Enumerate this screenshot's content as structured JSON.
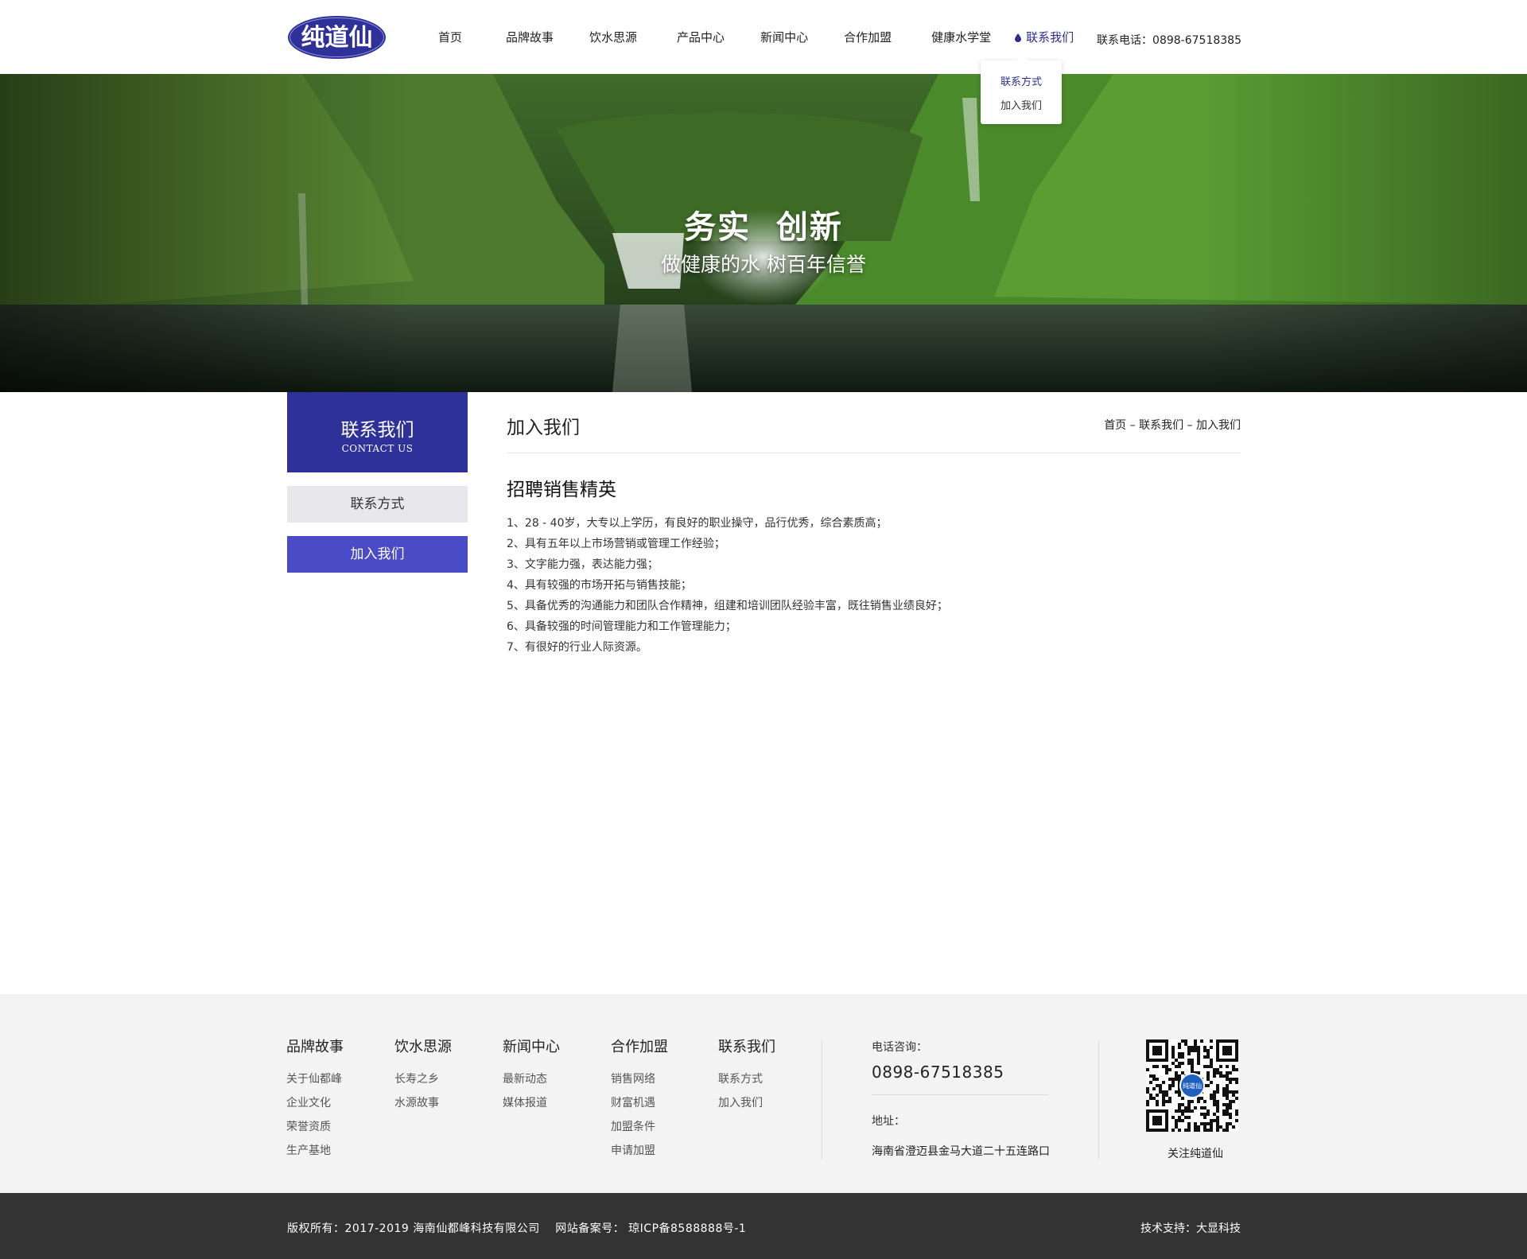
{
  "brand": {
    "logo_text": "纯道仙",
    "accent_color": "#2f319b"
  },
  "nav": {
    "items": [
      {
        "label": "首页"
      },
      {
        "label": "品牌故事"
      },
      {
        "label": "饮水思源"
      },
      {
        "label": "产品中心"
      },
      {
        "label": "新闻中心"
      },
      {
        "label": "合作加盟"
      },
      {
        "label": "健康水学堂"
      },
      {
        "label": "联系我们",
        "active": true
      }
    ],
    "phone": "联系电话：0898-67518385",
    "dropdown": [
      "联系方式",
      "加入我们"
    ]
  },
  "banner": {
    "title": "务实  创新",
    "subtitle": "做健康的水 树百年信誉"
  },
  "sidebar": {
    "heading": "联系我们",
    "heading_en": "CONTACT US",
    "items": [
      "联系方式",
      "加入我们"
    ]
  },
  "content": {
    "title": "加入我们",
    "breadcrumb": "首页 – 联系我们 – 加入我们",
    "article_title": "招聘销售精英",
    "requirements": [
      "1、28 - 40岁，大专以上学历，有良好的职业操守，品行优秀，综合素质高；",
      "2、具有五年以上市场营销或管理工作经验；",
      "3、文字能力强，表达能力强；",
      "4、具有较强的市场开拓与销售技能；",
      "5、具备优秀的沟通能力和团队合作精神，组建和培训团队经验丰富，既往销售业绩良好；",
      "6、具备较强的时间管理能力和工作管理能力；",
      "7、有很好的行业人际资源。"
    ]
  },
  "footer": {
    "columns": [
      {
        "heading": "品牌故事",
        "links": [
          "关于仙都峰",
          "企业文化",
          "荣誉资质",
          "生产基地"
        ]
      },
      {
        "heading": "饮水思源",
        "links": [
          "长寿之乡",
          "水源故事"
        ]
      },
      {
        "heading": "新闻中心",
        "links": [
          "最新动态",
          "媒体报道"
        ]
      },
      {
        "heading": "合作加盟",
        "links": [
          "销售网络",
          "财富机遇",
          "加盟条件",
          "申请加盟"
        ]
      },
      {
        "heading": "联系我们",
        "links": [
          "联系方式",
          "加入我们"
        ]
      }
    ],
    "tel_label": "电话咨询：",
    "tel": "0898-67518385",
    "address_label": "地址：",
    "address": "海南省澄迈县金马大道二十五连路口",
    "qr_caption": "关注纯道仙",
    "qr_center_text": "纯道仙"
  },
  "bottom": {
    "copyright": "版权所有：2017-2019 海南仙都峰科技有限公司　 网站备案号： 琼ICP备8588888号-1",
    "support": "技术支持：大显科技"
  }
}
